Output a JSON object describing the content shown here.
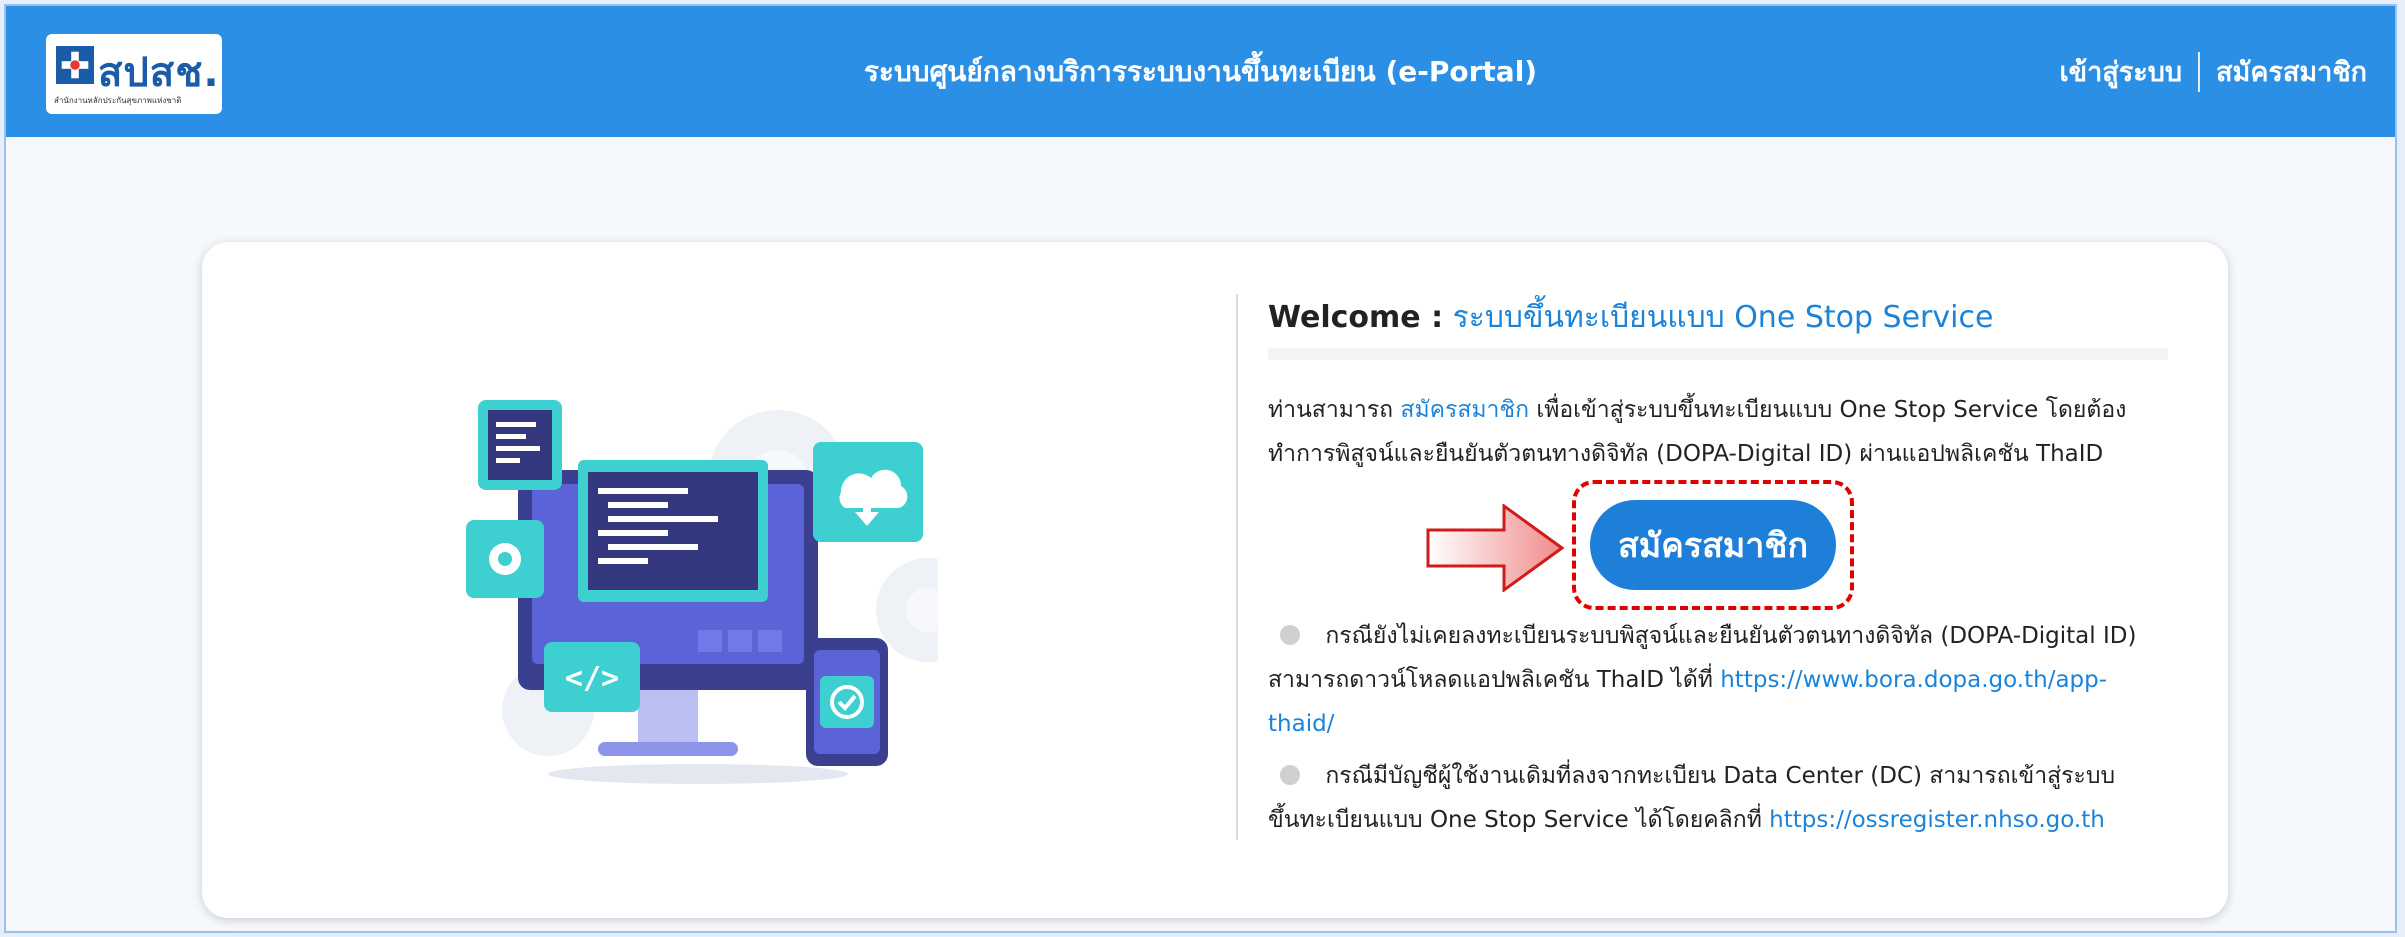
{
  "header": {
    "logo_text": "สปสช.",
    "logo_subtext": "สำนักงานหลักประกันสุขภาพแห่งชาติ",
    "title": "ระบบศูนย์กลางบริการระบบงานขึ้นทะเบียน (e-Portal)",
    "login_label": "เข้าสู่ระบบ",
    "register_label": "สมัครสมาชิก"
  },
  "welcome": {
    "label": "Welcome :",
    "subtitle": "ระบบขึ้นทะเบียนแบบ One Stop Service"
  },
  "intro": {
    "prefix": "ท่านสามารถ",
    "register_link": "สมัครสมาชิก",
    "suffix": "เพื่อเข้าสู่ระบบขึ้นทะเบียนแบบ One Stop Service โดยต้องทำการพิสูจน์และยืนยันตัวตนทางดิจิทัล (DOPA-Digital ID) ผ่านแอปพลิเคชัน ThaID"
  },
  "register_button": "สมัครสมาชิก",
  "info_items": [
    {
      "text": "กรณียังไม่เคยลงทะเบียนระบบพิสูจน์และยืนยันตัวตนทางดิจิทัล (DOPA-Digital ID) สามารถดาวน์โหลดแอปพลิเคชัน ThaID ได้ที่",
      "link": "https://www.bora.dopa.go.th/app-thaid/"
    },
    {
      "text": "กรณีมีบัญชีผู้ใช้งานเดิมที่ลงจากทะเบียน Data Center (DC) สามารถเข้าสู่ระบบ ขึ้นทะเบียนแบบ One Stop Service ได้โดยคลิกที่",
      "link": "https://ossregister.nhso.go.th"
    }
  ],
  "colors": {
    "header_bg": "#2b8fe6",
    "accent": "#1c83d8",
    "highlight": "#e10000"
  }
}
